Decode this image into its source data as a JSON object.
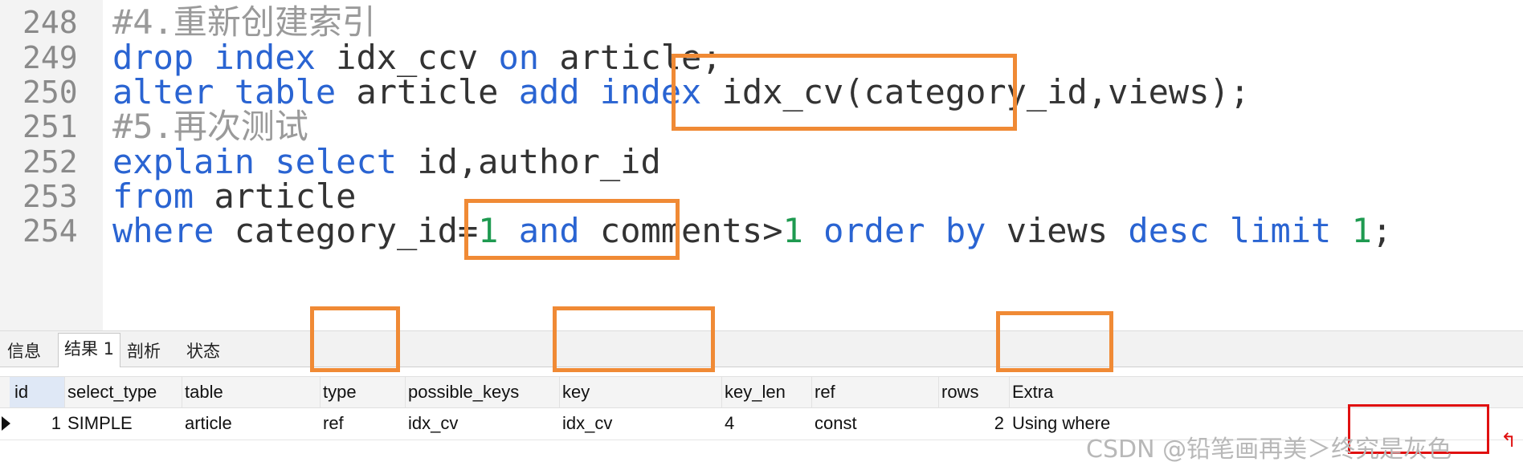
{
  "editor": {
    "lines": [
      {
        "no": "248",
        "tokens": [
          {
            "t": "cmt",
            "v": "#4."
          },
          {
            "t": "cmt-cjk",
            "v": "重新创建索引"
          }
        ]
      },
      {
        "no": "249",
        "tokens": [
          {
            "t": "kw",
            "v": "drop"
          },
          {
            "t": "id",
            "v": " "
          },
          {
            "t": "kw",
            "v": "index"
          },
          {
            "t": "id",
            "v": " idx_ccv "
          },
          {
            "t": "kw",
            "v": "on"
          },
          {
            "t": "id",
            "v": " article;"
          }
        ]
      },
      {
        "no": "250",
        "tokens": [
          {
            "t": "kw",
            "v": "alter"
          },
          {
            "t": "id",
            "v": " "
          },
          {
            "t": "kw",
            "v": "table"
          },
          {
            "t": "id",
            "v": " article "
          },
          {
            "t": "kw",
            "v": "add"
          },
          {
            "t": "id",
            "v": " "
          },
          {
            "t": "kw",
            "v": "index"
          },
          {
            "t": "id",
            "v": " idx_cv(category_id,views);"
          }
        ]
      },
      {
        "no": "251",
        "tokens": [
          {
            "t": "cmt",
            "v": "#5."
          },
          {
            "t": "cmt-cjk",
            "v": "再次测试"
          }
        ]
      },
      {
        "no": "252",
        "tokens": [
          {
            "t": "kw",
            "v": "explain"
          },
          {
            "t": "id",
            "v": " "
          },
          {
            "t": "kw",
            "v": "select"
          },
          {
            "t": "id",
            "v": " id,author_id"
          }
        ]
      },
      {
        "no": "253",
        "tokens": [
          {
            "t": "kw",
            "v": "from"
          },
          {
            "t": "id",
            "v": " article"
          }
        ]
      },
      {
        "no": "254",
        "tokens": [
          {
            "t": "kw",
            "v": "where"
          },
          {
            "t": "id",
            "v": " category_id="
          },
          {
            "t": "num",
            "v": "1"
          },
          {
            "t": "id",
            "v": " "
          },
          {
            "t": "kw",
            "v": "and"
          },
          {
            "t": "id",
            "v": " comments>"
          },
          {
            "t": "num",
            "v": "1"
          },
          {
            "t": "id",
            "v": " "
          },
          {
            "t": "kw",
            "v": "order"
          },
          {
            "t": "id",
            "v": " "
          },
          {
            "t": "kw",
            "v": "by"
          },
          {
            "t": "id",
            "v": " views "
          },
          {
            "t": "kw",
            "v": "desc"
          },
          {
            "t": "id",
            "v": " "
          },
          {
            "t": "kw",
            "v": "limit"
          },
          {
            "t": "id",
            "v": " "
          },
          {
            "t": "num",
            "v": "1"
          },
          {
            "t": "id",
            "v": ";"
          }
        ]
      }
    ]
  },
  "tabs": [
    "信息",
    "结果 1",
    "剖析",
    "状态"
  ],
  "active_tab": "结果 1",
  "result": {
    "columns": [
      "id",
      "select_type",
      "table",
      "type",
      "possible_keys",
      "key",
      "key_len",
      "ref",
      "rows",
      "Extra"
    ],
    "rows": [
      [
        "1",
        "SIMPLE",
        "article",
        "ref",
        "idx_cv",
        "idx_cv",
        "4",
        "const",
        "2",
        "Using where"
      ]
    ]
  },
  "watermark": "CSDN @铅笔画再美＞终究是灰色",
  "colors": {
    "keyword": "#2a64d2",
    "number": "#1e9a50",
    "comment": "#9a9a9a",
    "highlight": "#f08a35",
    "red_box": "#e01010"
  }
}
